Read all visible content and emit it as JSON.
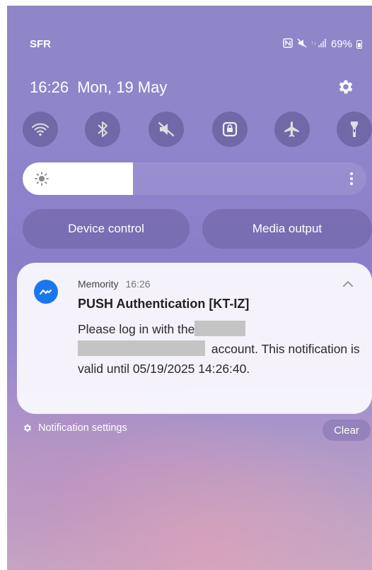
{
  "status_bar": {
    "carrier": "SFR",
    "battery_percent": "69%",
    "icons": [
      "nfc-icon",
      "mute-icon",
      "signal-icon",
      "battery-icon"
    ]
  },
  "header": {
    "time": "16:26",
    "date": "Mon, 19 May"
  },
  "quick_settings": [
    {
      "name": "wifi",
      "icon": "wifi-icon"
    },
    {
      "name": "bluetooth",
      "icon": "bluetooth-icon"
    },
    {
      "name": "sound",
      "icon": "mute-icon"
    },
    {
      "name": "rotation-lock",
      "icon": "rotation-lock-icon"
    },
    {
      "name": "airplane-mode",
      "icon": "airplane-icon"
    },
    {
      "name": "flashlight",
      "icon": "flashlight-icon"
    }
  ],
  "brightness": {
    "level": 0.32
  },
  "buttons": {
    "device_control": "Device control",
    "media_output": "Media output"
  },
  "notification": {
    "app_name": "Memority",
    "time": "16:26",
    "title": "PUSH Authentication [KT-IZ]",
    "body_part1": "Please log in with the",
    "body_part2": "account. This notification is valid until 05/19/2025 14:26:40."
  },
  "footer": {
    "settings_label": "Notification settings",
    "clear_label": "Clear"
  },
  "colors": {
    "accent_blue": "#1976f0",
    "tile_bg": "#5a508c"
  }
}
